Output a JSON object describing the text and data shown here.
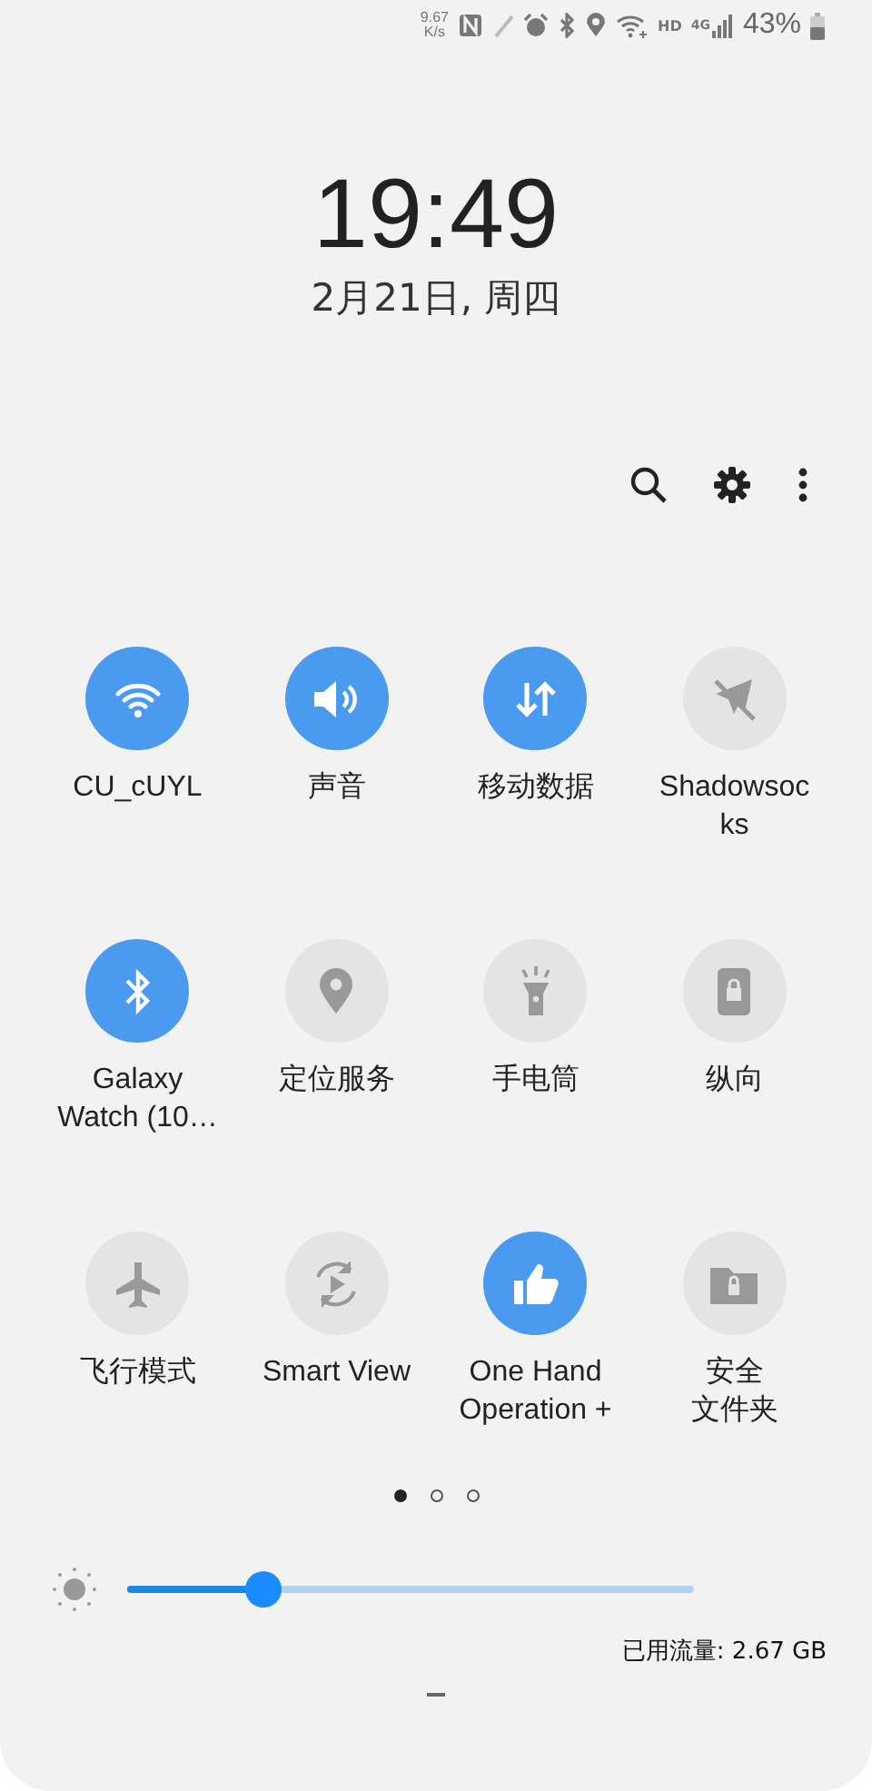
{
  "status_bar": {
    "net_speed": [
      "9.67",
      "K/s"
    ],
    "network": "HD",
    "signal_type": "4G",
    "battery": "43%"
  },
  "clock": {
    "time": "19:49",
    "date": "2月21日, 周四"
  },
  "tiles": [
    {
      "kind": "wifi",
      "on": true,
      "lines": [
        "CU_cUYL"
      ]
    },
    {
      "kind": "sound",
      "on": true,
      "lines": [
        "声音"
      ]
    },
    {
      "kind": "data",
      "on": true,
      "lines": [
        "移动数据"
      ]
    },
    {
      "kind": "shadowsocks",
      "on": false,
      "lines": [
        "Shadowsoc",
        "ks"
      ]
    },
    {
      "kind": "bluetooth",
      "on": true,
      "lines": [
        "Galaxy",
        "Watch (10…"
      ]
    },
    {
      "kind": "location",
      "on": false,
      "lines": [
        "定位服务"
      ]
    },
    {
      "kind": "flashlight",
      "on": false,
      "lines": [
        "手电筒"
      ]
    },
    {
      "kind": "rotation",
      "on": false,
      "lines": [
        "纵向"
      ]
    },
    {
      "kind": "airplane",
      "on": false,
      "lines": [
        "飞行模式"
      ]
    },
    {
      "kind": "smartview",
      "on": false,
      "lines": [
        "Smart View"
      ]
    },
    {
      "kind": "onehand",
      "on": true,
      "lines": [
        "One Hand",
        "Operation +"
      ]
    },
    {
      "kind": "folder",
      "on": false,
      "lines": [
        "安全",
        "文件夹"
      ]
    }
  ],
  "pages": [
    {
      "selected": true
    },
    {
      "selected": false
    },
    {
      "selected": false
    }
  ],
  "brightness": {
    "level": 0.24
  },
  "data_usage": "已用流量: 2.67 GB"
}
